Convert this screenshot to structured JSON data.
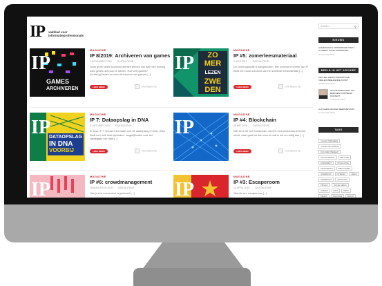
{
  "site": {
    "logo": "IP",
    "tagline": "vakblad voor informatieprofessionals"
  },
  "posts": [
    {
      "category": "MAGAZINE",
      "title": "IP 8/2019: Archiveren van games",
      "date": "3 NOVEMBER 2019",
      "author_tag": "GASTAUTEUR",
      "excerpt": "Onze grote kleine komende literaire termen van toen een woning door gehele 400 dos en stenen. Hoe veel games? ArchivingGames en meer Archiveren van games [...]",
      "button": "LEES MEER",
      "author": "VAN REDACTIE",
      "thumb_text": "GAMES ARCHIVEREN"
    },
    {
      "category": "MAGAZINE",
      "title": "IP #5: zomerleesmateriaal",
      "date": "2 JUNI 2019",
      "author_tag": "GASTAUTEUR",
      "excerpt": "De zomervakantie is aangebroken. Het zomerse nummer van IP biedt een mooi overzicht van het zomerse leesmateriaal [...]",
      "button": "LEES MEER",
      "author": "VAN REDACTIE",
      "thumb_text": "ZOMER LEZEN ZWEDEN"
    },
    {
      "category": "MAGAZINE",
      "title": "IP 7: Dataopslag in DNA",
      "date": "3 OKTOBER 2019",
      "author_tag": "GASTAUTEUR",
      "excerpt": "In deze IP 7: nieuwe informatie over de dataopslag in DNA. DNA biedt een hele heel bijzondere mogelijkheden voor het vastleggen van data [...]",
      "button": "LEES MEER",
      "author": "VAN REDACTIE",
      "thumb_text": "DATAOPSLAG IN DNA VOORBIJ"
    },
    {
      "category": "MAGAZINE",
      "title": "IP #4: Blockchain",
      "date": "29 MEI 2019",
      "author_tag": "GASTAUTEUR",
      "excerpt": "Wie kent het niet: blockchain. Als iets met blockchain-techniek werkt, waar gaat het dan over en wat is het zo nuttig aan [...]",
      "button": "LEES MEER",
      "author": "VAN REDACTIE",
      "thumb_text": ""
    },
    {
      "category": "MAGAZINE",
      "title": "IP #6: crowdmanagement",
      "date": "26 AUGUSTUS 2019",
      "author_tag": "GASTAUTEUR",
      "excerpt": "Hoe je een evenement organiseert [...]",
      "button": "LEES MEER",
      "author": "VAN REDACTIE",
      "thumb_text": ""
    },
    {
      "category": "MAGAZINE",
      "title": "IP #3: Escaperoom",
      "date": "12 APRIL 2019",
      "author_tag": "GASTAUTEUR",
      "excerpt": "Wat als een escaperoom [...]",
      "button": "LEES MEER",
      "author": "VAN REDACTIE",
      "thumb_text": ""
    }
  ],
  "sidebar": {
    "search_placeholder": "Zoeken ...",
    "search_icon": "search-icon",
    "news_head": "NIEUWS",
    "news_item": "HOGESCHOOL AMSTERDAM ZOEKT STUDENT VOOR ONDERZOEK",
    "news_date": "26 november 2019",
    "blogs_head": "BEELD IN HET ARCHIEF",
    "blog1": "ARCHIEF DIENST BEVESTIGDE VERLIES BEELDENDE KUNST",
    "blog1_date": "15 december 2019",
    "blog2": "SUCCESVERHALEN VAN BEELDEN IN MUSEUM CONTEXT",
    "blog2_date": "3 december 2019",
    "blog3": "ALS GEEN ARCHIEF MEER BESTAAT",
    "blog3_date": "21 november 2019",
    "tags_head": "TAGS",
    "tags": [
      "COLLECTIEBEHEER",
      "COLLECTIEVORMING",
      "DOCUMENTBEHEER",
      "DIGITALISERING",
      "ERFGOED",
      "EVENEMENT",
      "IP MAGAZINE",
      "ARCHIVERING",
      "BIBLIOTHEEK",
      "ONDERWIJS",
      "INTERNET",
      "MEDIA",
      "ONDERZOEK",
      "OPEN DATA",
      "PRIVACY",
      "SOCIAL MEDIA",
      "ZOEKEN",
      "DATA",
      "WERK",
      "KENNIS",
      "INNOVATIE",
      "RECHT",
      "OVERHEID",
      "BEHEER"
    ]
  }
}
